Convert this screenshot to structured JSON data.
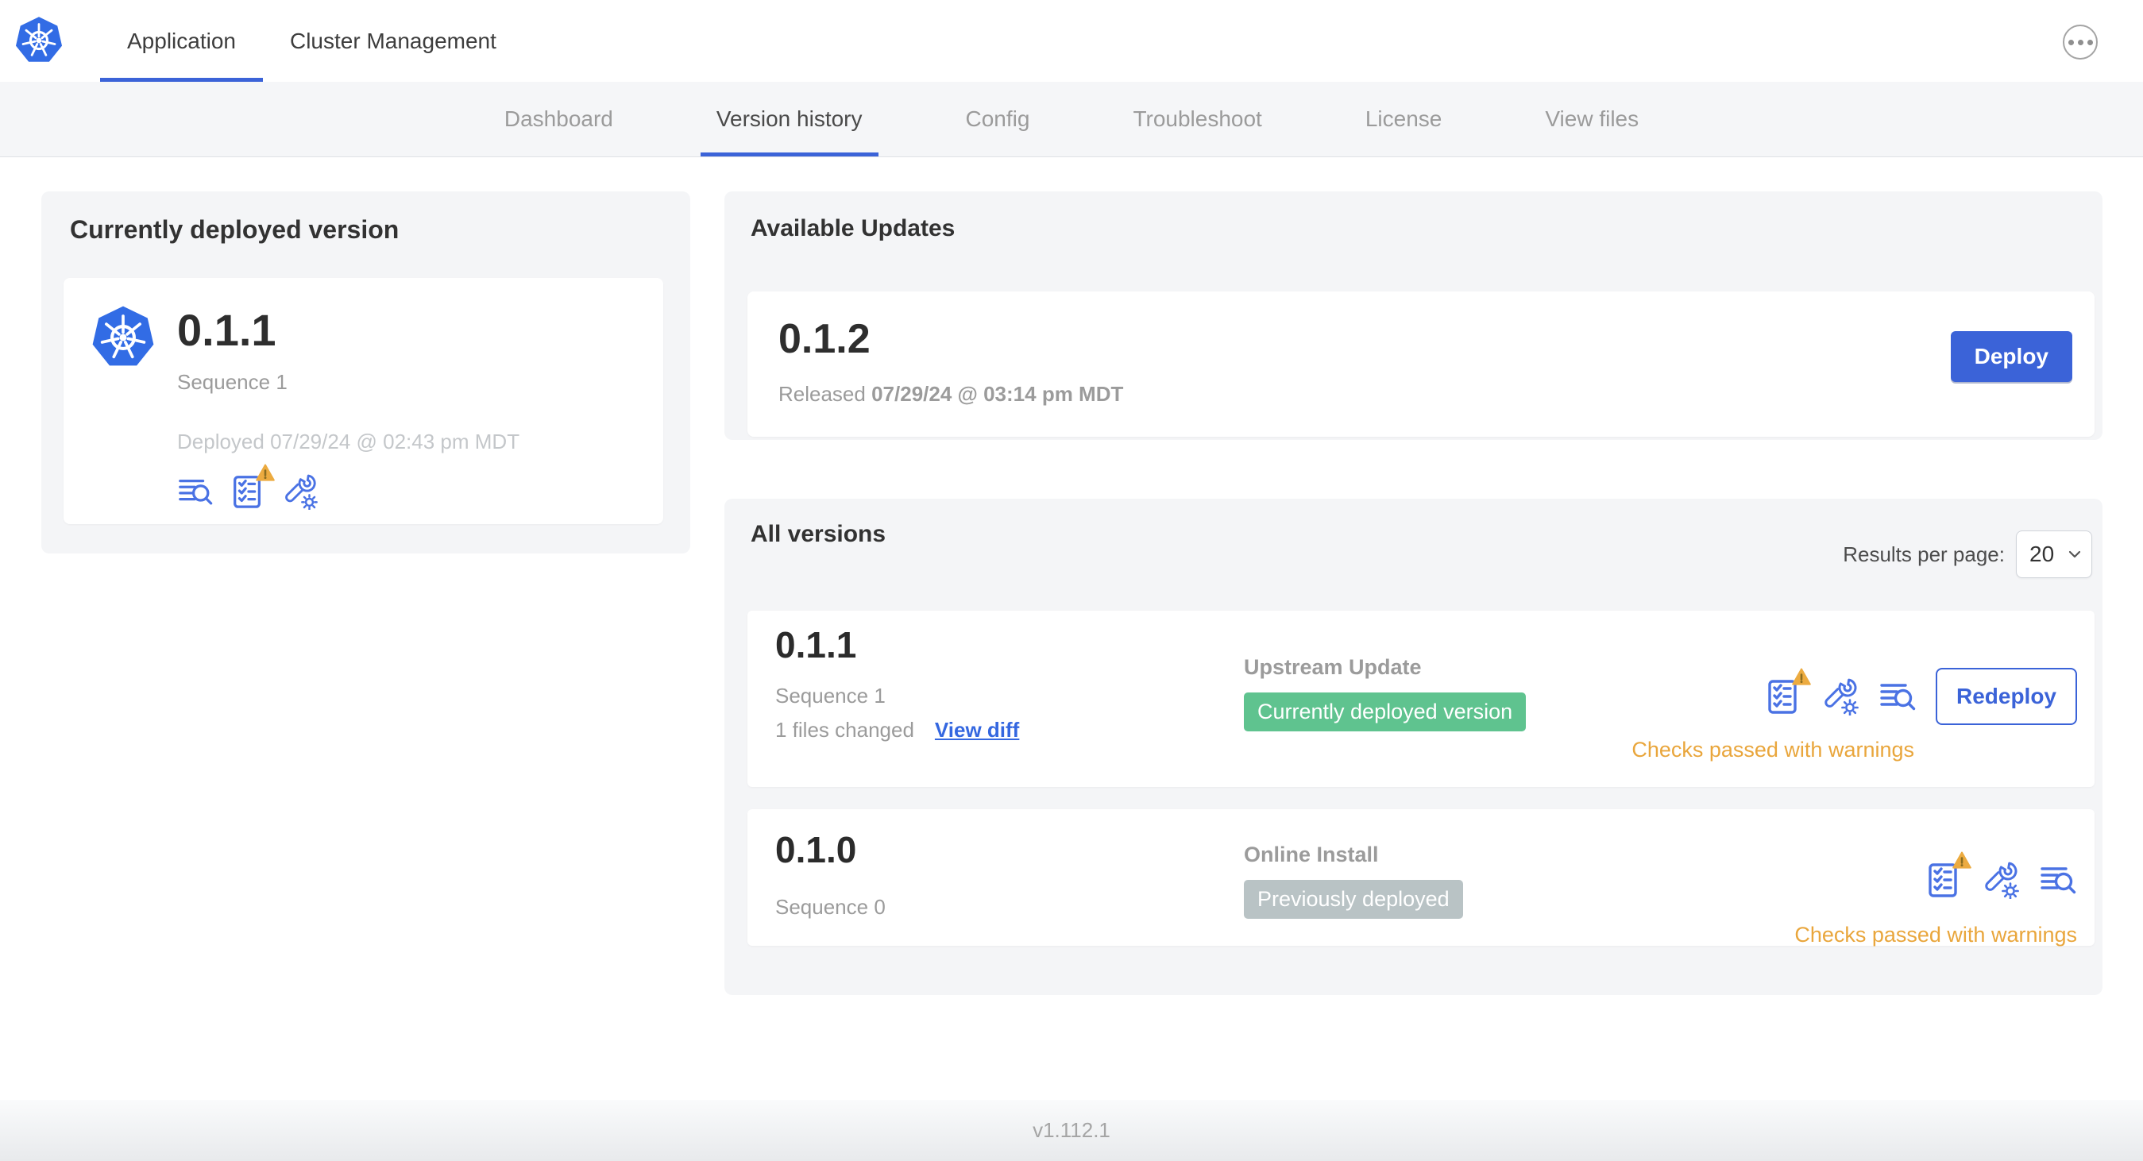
{
  "topbar": {
    "tabs": [
      {
        "label": "Application",
        "active": true
      },
      {
        "label": "Cluster Management",
        "active": false
      }
    ]
  },
  "subnav": {
    "tabs": [
      {
        "label": "Dashboard",
        "active": false
      },
      {
        "label": "Version history",
        "active": true
      },
      {
        "label": "Config",
        "active": false
      },
      {
        "label": "Troubleshoot",
        "active": false
      },
      {
        "label": "License",
        "active": false
      },
      {
        "label": "View files",
        "active": false
      }
    ]
  },
  "current_version": {
    "title": "Currently deployed version",
    "version": "0.1.1",
    "sequence": "Sequence 1",
    "deployed": "Deployed 07/29/24 @ 02:43 pm MDT"
  },
  "available_updates": {
    "title": "Available Updates",
    "version": "0.1.2",
    "released_label": "Released",
    "released_date": "07/29/24 @ 03:14 pm MDT",
    "deploy_label": "Deploy"
  },
  "all_versions": {
    "title": "All versions",
    "results_per_page_label": "Results per page:",
    "results_per_page_value": "20",
    "rows": [
      {
        "version": "0.1.1",
        "sequence": "Sequence 1",
        "files_changed": "1 files changed",
        "view_diff_label": "View diff",
        "source_label": "Upstream Update",
        "badge": "Currently deployed version",
        "status": "Checks passed with warnings",
        "action_label": "Redeploy"
      },
      {
        "version": "0.1.0",
        "sequence": "Sequence 0",
        "source_label": "Online Install",
        "badge": "Previously deployed",
        "status": "Checks passed with warnings"
      }
    ]
  },
  "footer": {
    "version": "v1.112.1"
  },
  "icons": {
    "brand": "kubernetes-logo",
    "overflow": "ellipsis-menu-icon",
    "version_actions": [
      "logs-icon",
      "preflight-checks-icon",
      "config-icon"
    ],
    "overlay": "warning-triangle-icon",
    "select": "chevron-down-icon"
  },
  "colors": {
    "accent_blue": "#3b63d8",
    "link_blue": "#3467e0",
    "icon_blue": "#4a72e4",
    "kubernetes_blue": "#326ce5",
    "badge_green": "#5fc38f",
    "badge_gray": "#b9c3c5",
    "warning_amber": "#e9a63c",
    "panel_gray": "#f4f5f7"
  }
}
